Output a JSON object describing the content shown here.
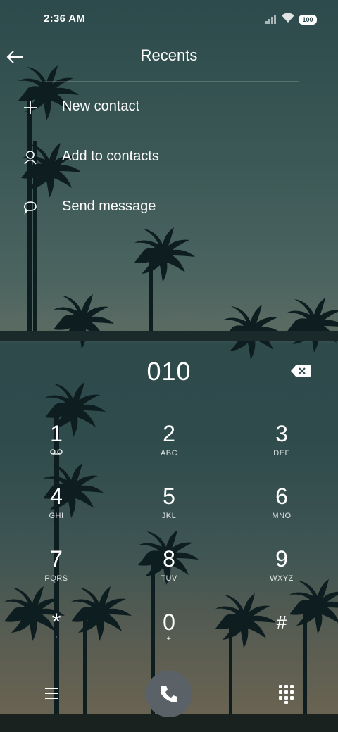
{
  "status_bar": {
    "time": "2:36 AM",
    "battery": "100"
  },
  "header": {
    "title": "Recents",
    "back_icon": "arrow-left-icon"
  },
  "menu": [
    {
      "label": "New contact",
      "icon": "plus-icon"
    },
    {
      "label": "Add to contacts",
      "icon": "person-icon"
    },
    {
      "label": "Send message",
      "icon": "message-bubble-icon"
    }
  ],
  "dialer": {
    "number": "010",
    "keys": [
      {
        "digit": "1",
        "letters": ""
      },
      {
        "digit": "2",
        "letters": "ABC"
      },
      {
        "digit": "3",
        "letters": "DEF"
      },
      {
        "digit": "4",
        "letters": "GHI"
      },
      {
        "digit": "5",
        "letters": "JKL"
      },
      {
        "digit": "6",
        "letters": "MNO"
      },
      {
        "digit": "7",
        "letters": "PQRS"
      },
      {
        "digit": "8",
        "letters": "TUV"
      },
      {
        "digit": "9",
        "letters": "WXYZ"
      },
      {
        "digit": "*",
        "letters": ","
      },
      {
        "digit": "0",
        "letters": "+"
      },
      {
        "digit": "#",
        "letters": ""
      }
    ]
  },
  "colors": {
    "call_button": "#5a6268",
    "text": "#ffffff"
  }
}
